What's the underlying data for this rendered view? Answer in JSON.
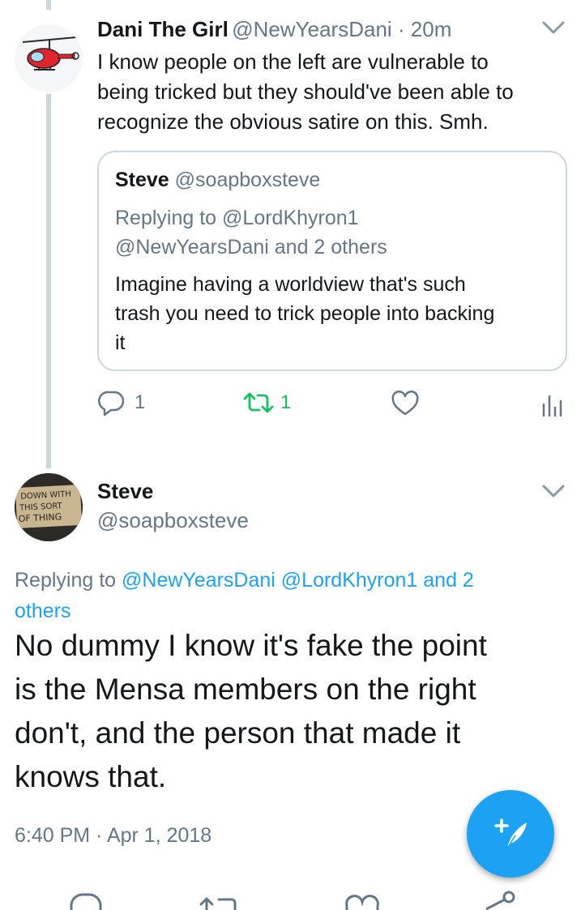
{
  "reply_tweet": {
    "author_name": "Dani The Girl",
    "author_handle": "@NewYearsDani",
    "time_sep": " · ",
    "time": "20m",
    "text_lines": [
      "I know people on the left are vulnerable to",
      "being tricked but they should've been able to",
      "recognize the obvious satire on this. Smh."
    ],
    "quoted": {
      "author_name": "Steve",
      "author_handle": "@soapboxsteve",
      "replying_prefix": "Replying to ",
      "replying_user": "@LordKhyron1",
      "replying_line2_user": "@NewYearsDani",
      "replying_line2_rest": " and 2 others",
      "text_lines": [
        "Imagine having a worldview that's such",
        "trash you need to trick people into backing",
        "it"
      ]
    },
    "actions": {
      "reply_count": "1",
      "retweet_count": "1"
    },
    "retweet_color": "#17bf63"
  },
  "main_tweet": {
    "author_name": "Steve",
    "author_handle": "@soapboxsteve",
    "avatar_sign_lines": [
      "DOWN WITH",
      "THIS SORT",
      "OF THING"
    ],
    "replying_prefix": "Replying to ",
    "replying_users": "@NewYearsDani @LordKhyron1 and 2",
    "replying_users_line2": "others",
    "text_lines": [
      "No dummy I know it's fake the point",
      "is the Mensa members on the right",
      "don't, and the person that made it",
      "knows that."
    ],
    "timestamp": "6:40 PM · Apr 1, 2018"
  },
  "colors": {
    "accent": "#1da1f2",
    "secondary_text": "#657786",
    "border": "#ccd6dd"
  },
  "icons": [
    "chevron-down-icon",
    "reply-icon",
    "retweet-icon",
    "like-icon",
    "analytics-icon",
    "compose-tweet-icon"
  ]
}
